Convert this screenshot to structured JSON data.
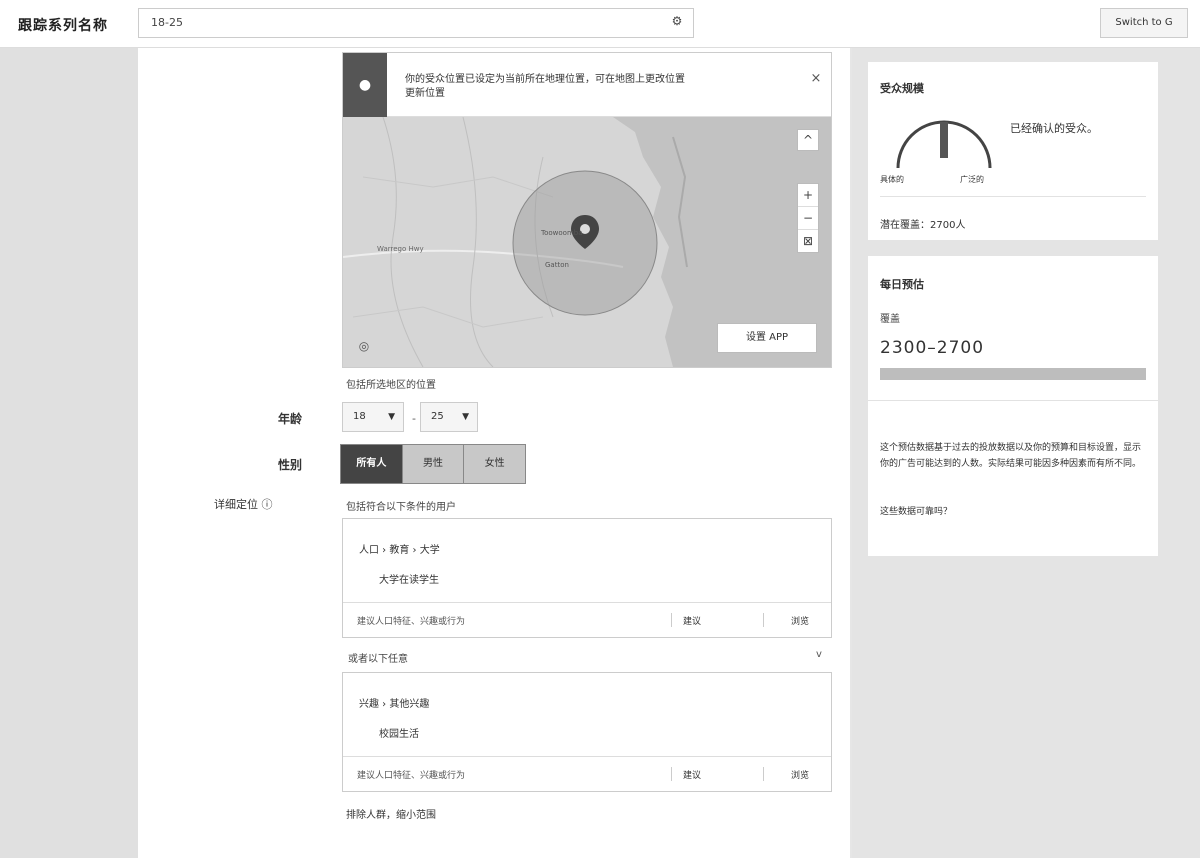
{
  "topbar": {
    "ad_name_label": "跟踪系列名称",
    "ad_name_value": "18-25",
    "switch_label": "Switch to G"
  },
  "map": {
    "notice_text": "你的受众位置已设定为当前所在地理位置，可在地图上更改位置",
    "notice_line2": "更新位置",
    "edit_button": "设置 APP",
    "footer_text": "包括所选地区的位置"
  },
  "age": {
    "label": "年龄",
    "min": "18",
    "max": "25"
  },
  "gender": {
    "label": "性别",
    "options": [
      "所有人",
      "男性",
      "女性"
    ],
    "selected": "所有人"
  },
  "targeting": {
    "label": "详细定位",
    "hint": "包括符合以下条件的用户",
    "box1": {
      "path": "人口 › 教育 › 大学",
      "sub": "大学在读学生",
      "footer": "建议人口特征、兴趣或行为",
      "btn1": "建议",
      "btn2": "浏览"
    },
    "or_text": "或者以下任意",
    "box2": {
      "path": "兴趣 › 其他兴趣",
      "sub": "校园生活",
      "footer": "建议人口特征、兴趣或行为",
      "btn1": "建议",
      "btn2": "浏览"
    },
    "narrow_link": "排除人群，缩小范围"
  },
  "audience": {
    "title": "受众规模",
    "gauge_text": "已经确认的受众。",
    "min_label": "具体的",
    "max_label": "广泛的",
    "reach": "潜在覆盖：2700人",
    "level": 0.5
  },
  "estimate": {
    "title": "每日预估",
    "sub": "覆盖",
    "range": "2300–2700",
    "desc": "这个预估数据基于过去的投放数据以及你的预算和目标设置，显示你的广告可能达到的人数。实际结果可能因多种因素而有所不同。",
    "help": "这些数据可靠吗？"
  }
}
